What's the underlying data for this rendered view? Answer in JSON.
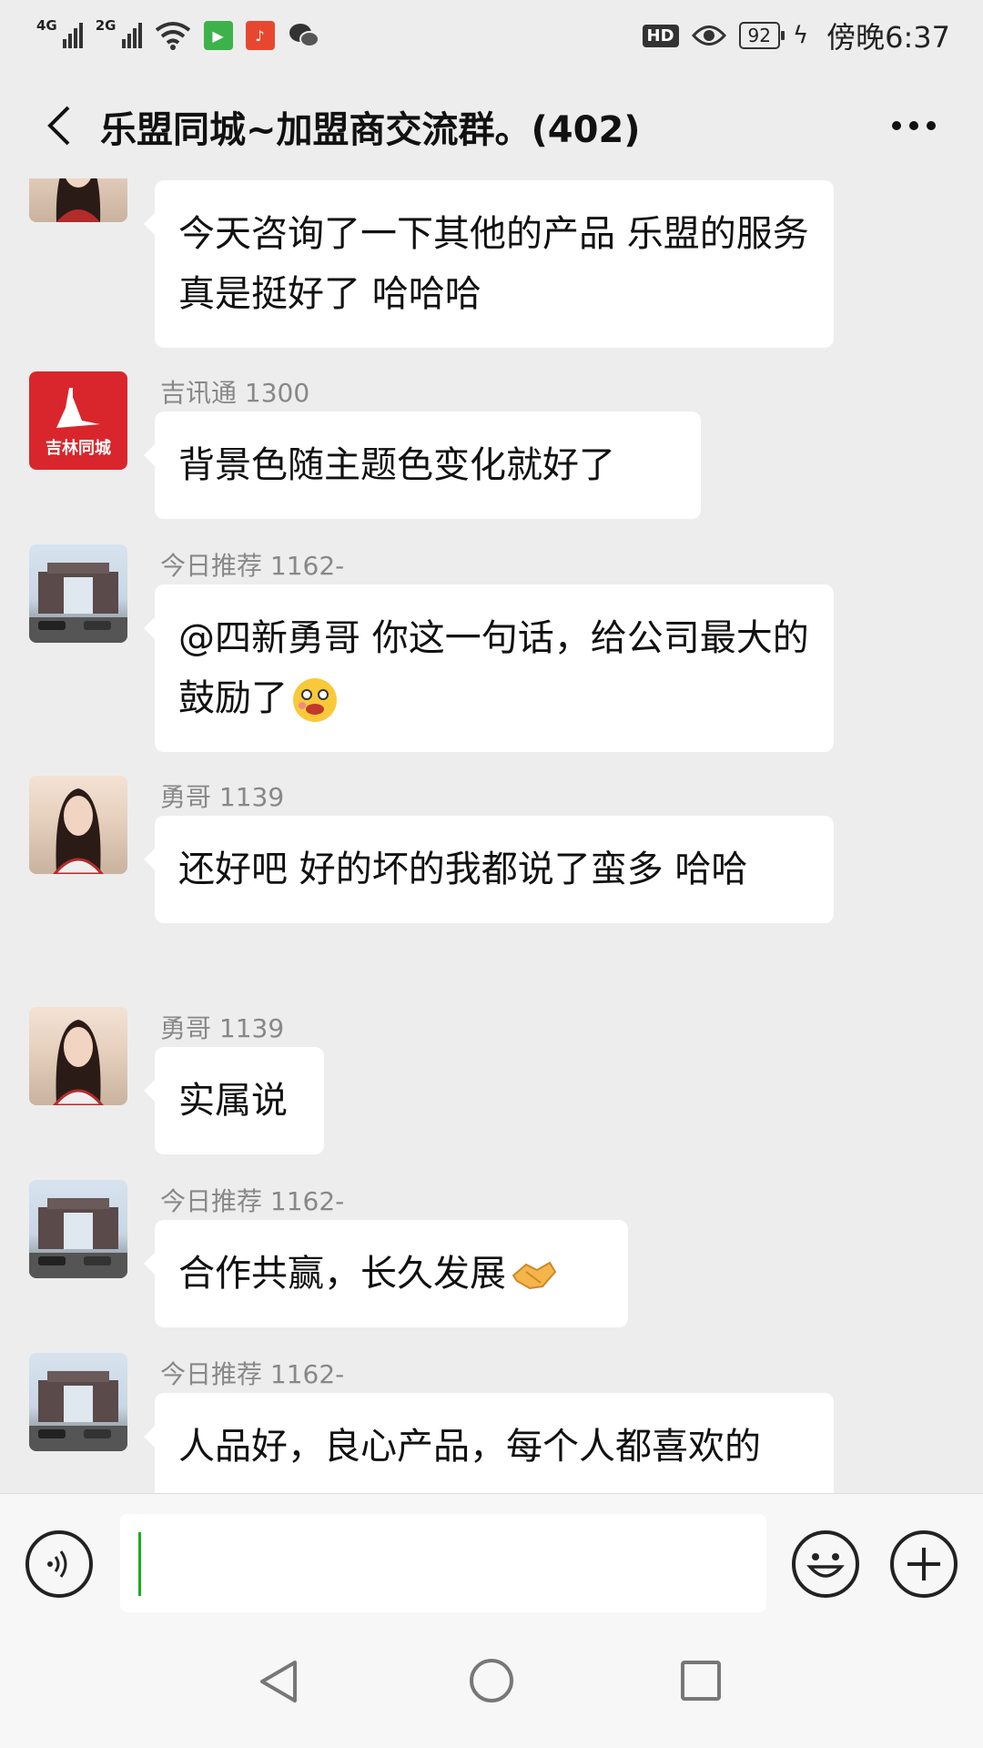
{
  "status_bar": {
    "network1": "4G",
    "network2": "2G",
    "hd": "HD",
    "battery": "92",
    "time": "傍晚6:37"
  },
  "header": {
    "title": "乐盟同城~加盟商交流群。(402)"
  },
  "messages": [
    {
      "sender": "",
      "text": "今天咨询了一下其他的产品 乐盟的服务 真是挺好了 哈哈哈"
    },
    {
      "sender": "吉讯通 1300",
      "text": "背景色随主题色变化就好了",
      "avatar_text": "吉林同城"
    },
    {
      "sender": "今日推荐 1162-",
      "text": "@四新勇哥  你这一句话，给公司最大的鼓励了"
    },
    {
      "sender": "勇哥 1139",
      "text": "还好吧  好的坏的我都说了蛮多 哈哈"
    },
    {
      "sender": "勇哥 1139",
      "text": "实属说"
    },
    {
      "sender": "今日推荐 1162-",
      "text": "合作共赢，长久发展"
    },
    {
      "sender": "今日推荐 1162-",
      "text": "人品好，良心产品，每个人都喜欢的"
    }
  ],
  "icons": {
    "back": "chevron-left-icon",
    "more": "more-dots-icon",
    "voice": "voice-icon",
    "emoji": "smile-icon",
    "plus": "plus-icon"
  },
  "colors": {
    "background": "#ededed",
    "bubble": "#ffffff",
    "caret": "#1aad19",
    "avatar_red": "#d9262c"
  }
}
